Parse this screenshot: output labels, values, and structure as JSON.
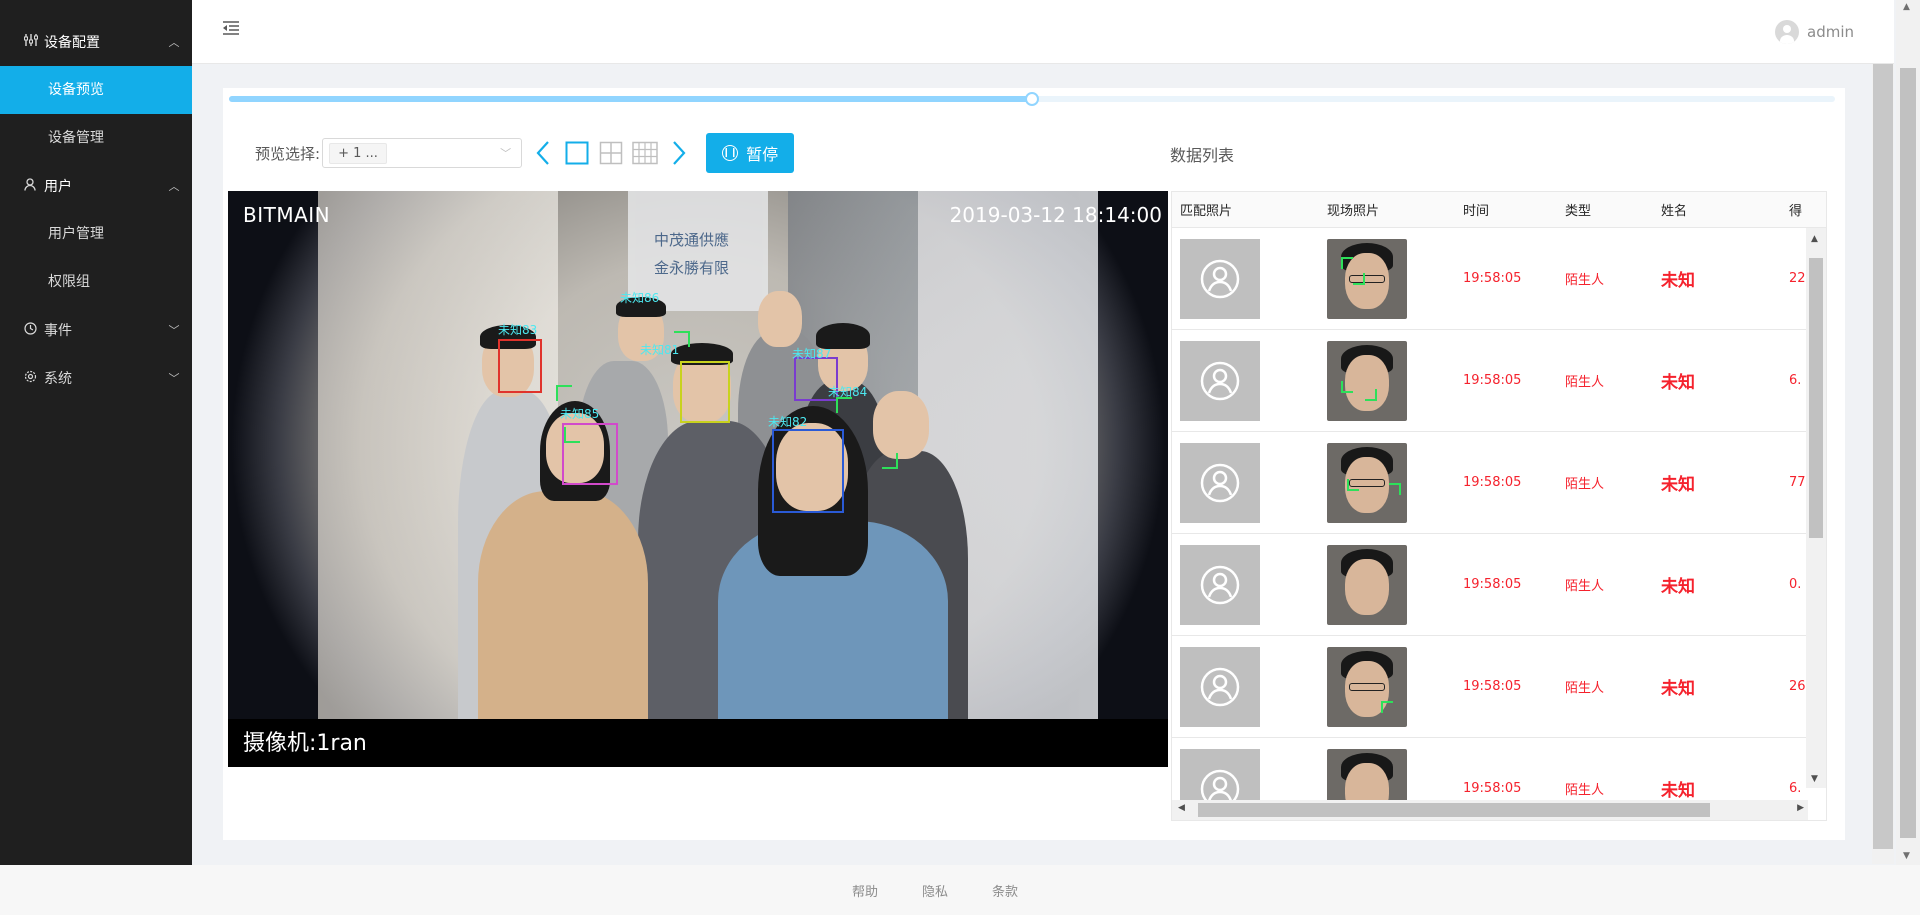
{
  "sidebar": {
    "groups": [
      {
        "label": "设备配置",
        "icon": "sliders-icon",
        "items": [
          "设备预览",
          "设备管理"
        ]
      },
      {
        "label": "用户",
        "icon": "user-icon",
        "items": [
          "用户管理",
          "权限组"
        ]
      },
      {
        "label": "事件",
        "icon": "clock-icon",
        "items": []
      },
      {
        "label": "系统",
        "icon": "gear-icon",
        "items": []
      }
    ],
    "active_item": "设备预览"
  },
  "header": {
    "username": "admin"
  },
  "toolbar": {
    "preview_label": "预览选择:",
    "select_value": "+ 1 ...",
    "pause_label": "暂停"
  },
  "list_title": "数据列表",
  "video": {
    "brand": "BITMAIN",
    "timestamp": "2019-03-12  18:14:00",
    "camera": "摄像机:1ran",
    "sign_lines": [
      "中茂通供應",
      "金永勝有限"
    ],
    "faces": [
      {
        "label": "未知83",
        "color": "#e0332c"
      },
      {
        "label": "未知86",
        "color": "#2de05a"
      },
      {
        "label": "未知81",
        "color": "#c8d21e"
      },
      {
        "label": "未知87",
        "color": "#7a3ccf"
      },
      {
        "label": "未知84",
        "color": "#2de05a"
      },
      {
        "label": "未知85",
        "color": "#d14acb"
      },
      {
        "label": "未知82",
        "color": "#2a5ad6"
      }
    ]
  },
  "table": {
    "columns": [
      "匹配照片",
      "现场照片",
      "时间",
      "类型",
      "姓名",
      "得"
    ],
    "rows": [
      {
        "time": "19:58:05",
        "type": "陌生人",
        "name": "未知",
        "score": "22"
      },
      {
        "time": "19:58:05",
        "type": "陌生人",
        "name": "未知",
        "score": "6."
      },
      {
        "time": "19:58:05",
        "type": "陌生人",
        "name": "未知",
        "score": "77"
      },
      {
        "time": "19:58:05",
        "type": "陌生人",
        "name": "未知",
        "score": "0."
      },
      {
        "time": "19:58:05",
        "type": "陌生人",
        "name": "未知",
        "score": "26"
      },
      {
        "time": "19:58:05",
        "type": "陌生人",
        "name": "未知",
        "score": "6."
      }
    ]
  },
  "preview_progress": 0.5,
  "footer": {
    "links": [
      "帮助",
      "隐私",
      "条款"
    ]
  },
  "colors": {
    "accent": "#13aee9",
    "sidebar_bg": "#1f1f1f",
    "danger": "#f5222d"
  }
}
